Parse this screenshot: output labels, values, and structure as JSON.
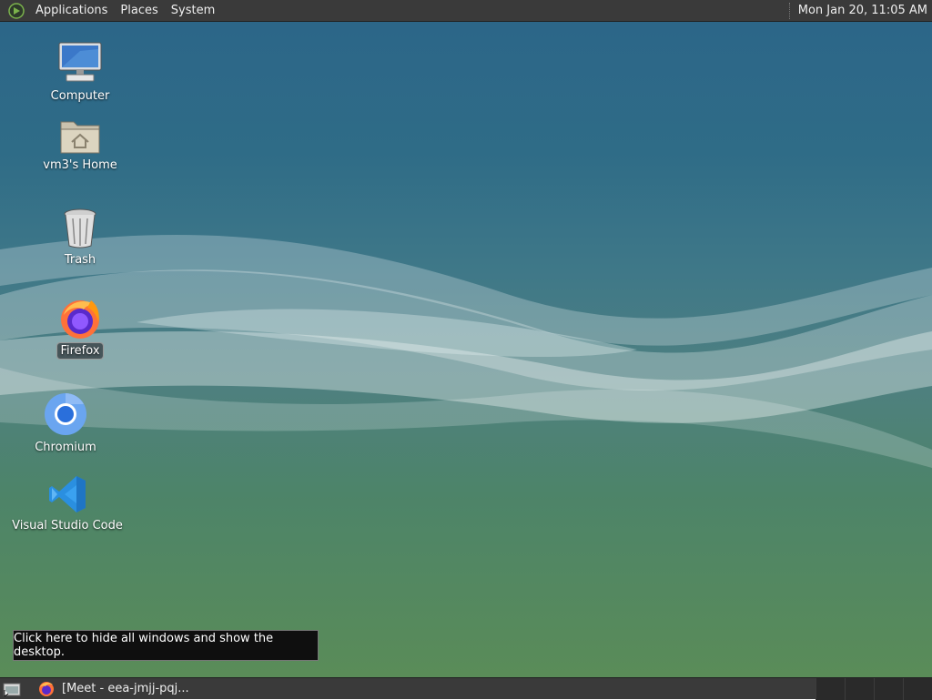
{
  "top_panel": {
    "menus": [
      "Applications",
      "Places",
      "System"
    ],
    "clock": "Mon Jan 20, 11:05 AM"
  },
  "desktop": {
    "icons": [
      {
        "label": "Computer",
        "icon": "computer-icon"
      },
      {
        "label": "vm3's Home",
        "icon": "home-folder-icon"
      },
      {
        "label": "Trash",
        "icon": "trash-icon"
      },
      {
        "label": "Firefox",
        "icon": "firefox-icon",
        "selected": true
      },
      {
        "label": "Chromium",
        "icon": "chromium-icon"
      },
      {
        "label": "Visual Studio Code",
        "icon": "vscode-icon"
      }
    ]
  },
  "tooltip": {
    "text": "Click here to hide all windows and show the desktop."
  },
  "bottom_panel": {
    "task": "[Meet - eea-jmjj-pqj..."
  },
  "colors": {
    "panel": "#3a3a3a",
    "desktop_top": "#2c6688",
    "desktop_bottom": "#5a8c58"
  }
}
